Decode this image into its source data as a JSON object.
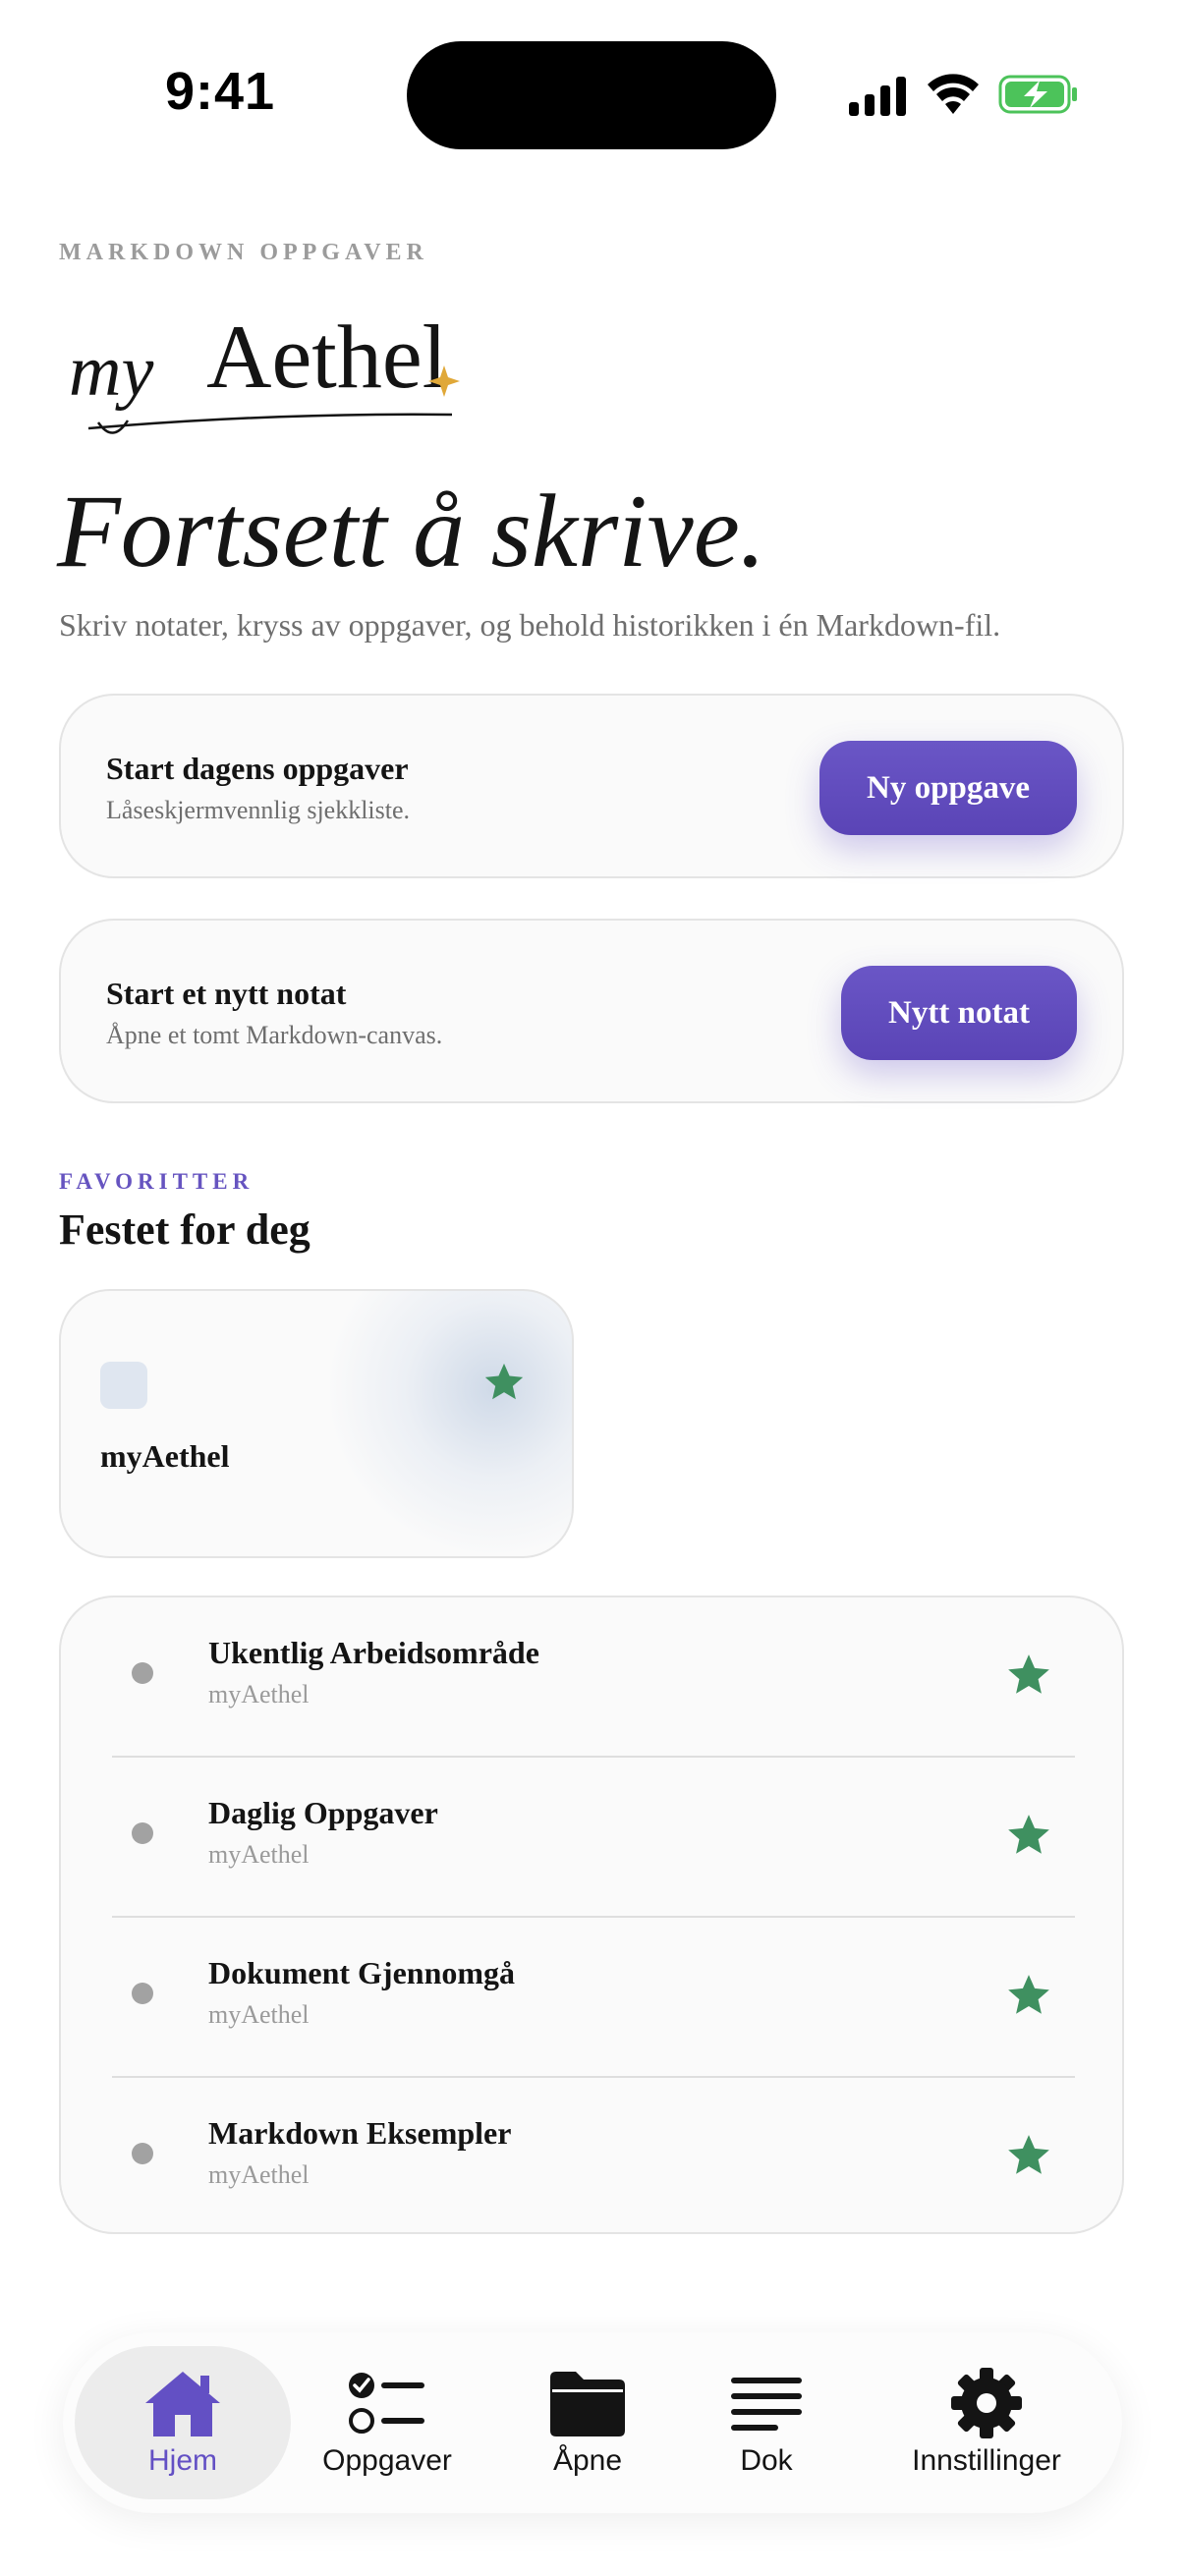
{
  "status": {
    "time": "9:41"
  },
  "header": {
    "eyebrow": "MARKDOWN OPPGAVER",
    "logo_text_script": "my",
    "logo_text_main": "Aethel",
    "hero": "Fortsett å skrive.",
    "subtitle": "Skriv notater, kryss av oppgaver, og behold historikken i én Markdown-fil."
  },
  "actions": [
    {
      "title": "Start dagens oppgaver",
      "subtitle": "Låseskjermvennlig sjekkliste.",
      "button": "Ny oppgave"
    },
    {
      "title": "Start et nytt notat",
      "subtitle": "Åpne et tomt Markdown-canvas.",
      "button": "Nytt notat"
    }
  ],
  "favorites": {
    "eyebrow": "FAVORITTER",
    "title": "Festet for deg",
    "card": {
      "name": "myAethel"
    }
  },
  "list": [
    {
      "title": "Ukentlig Arbeidsområde",
      "subtitle": "myAethel"
    },
    {
      "title": "Daglig Oppgaver",
      "subtitle": "myAethel"
    },
    {
      "title": "Dokument Gjennomgå",
      "subtitle": "myAethel"
    },
    {
      "title": "Markdown Eksempler",
      "subtitle": "myAethel"
    }
  ],
  "tabs": [
    {
      "label": "Hjem",
      "icon": "house-icon",
      "active": true
    },
    {
      "label": "Oppgaver",
      "icon": "checklist-icon"
    },
    {
      "label": "Åpne",
      "icon": "folder-icon"
    },
    {
      "label": "Dok",
      "icon": "text-lines-icon"
    },
    {
      "label": "Innstillinger",
      "icon": "gear-icon"
    }
  ],
  "colors": {
    "accent": "#5f4bc0",
    "star": "#3f9060",
    "logo_spark": "#e0a838"
  }
}
